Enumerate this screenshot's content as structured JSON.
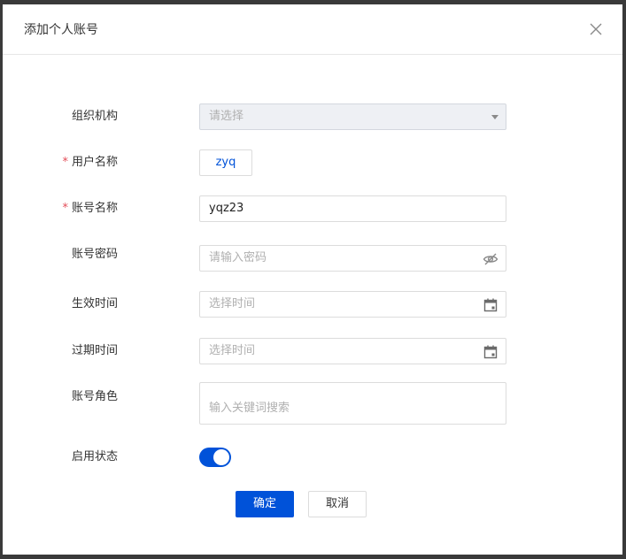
{
  "dialog": {
    "title": "添加个人账号",
    "close_icon": "close-icon"
  },
  "form": {
    "org": {
      "label": "组织机构",
      "placeholder": "请选择",
      "required": false
    },
    "username": {
      "label": "用户名称",
      "value": "zyq",
      "required": true,
      "required_mark": "*"
    },
    "account_name": {
      "label": "账号名称",
      "value": "yqz23",
      "required": true,
      "required_mark": "*"
    },
    "password": {
      "label": "账号密码",
      "placeholder": "请输入密码",
      "icon": "eye-off-icon"
    },
    "effective_time": {
      "label": "生效时间",
      "placeholder": "选择时间",
      "icon": "calendar-icon"
    },
    "expire_time": {
      "label": "过期时间",
      "placeholder": "选择时间",
      "icon": "calendar-icon"
    },
    "role": {
      "label": "账号角色",
      "placeholder": "输入关键词搜索"
    },
    "status": {
      "label": "启用状态",
      "enabled": true
    }
  },
  "actions": {
    "confirm_label": "确定",
    "cancel_label": "取消"
  },
  "colors": {
    "primary": "#0052d9",
    "required": "#e34d59"
  }
}
